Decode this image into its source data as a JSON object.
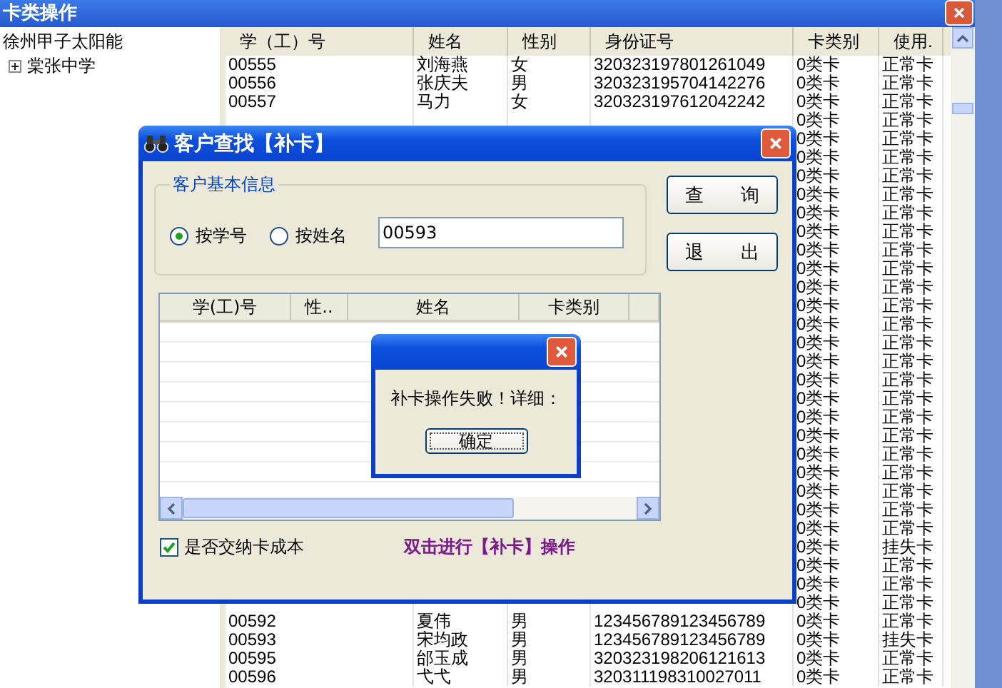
{
  "main_window": {
    "title": "卡类操作",
    "tree": {
      "root": "徐州甲子太阳能",
      "children": [
        {
          "label": "棠张中学",
          "expanded": false
        }
      ]
    },
    "table": {
      "columns": [
        "学（工）号",
        "姓名",
        "性别",
        "身份证号",
        "卡类别",
        "使用."
      ],
      "rows": [
        {
          "id": "00555",
          "name": "刘海燕",
          "gender": "女",
          "id_card": "320323197801261049",
          "card_type": "0类卡",
          "status": "正常卡"
        },
        {
          "id": "00556",
          "name": "张庆夫",
          "gender": "男",
          "id_card": "320323195704142276",
          "card_type": "0类卡",
          "status": "正常卡"
        },
        {
          "id": "00557",
          "name": "马力",
          "gender": "女",
          "id_card": "320323197612042242",
          "card_type": "0类卡",
          "status": "正常卡"
        },
        {
          "card_type": "0类卡",
          "status": "正常卡"
        },
        {
          "card_type": "0类卡",
          "status": "正常卡"
        },
        {
          "card_type": "0类卡",
          "status": "正常卡"
        },
        {
          "card_type": "0类卡",
          "status": "正常卡"
        },
        {
          "card_type": "0类卡",
          "status": "正常卡"
        },
        {
          "card_type": "0类卡",
          "status": "正常卡"
        },
        {
          "card_type": "0类卡",
          "status": "正常卡"
        },
        {
          "card_type": "0类卡",
          "status": "正常卡"
        },
        {
          "card_type": "0类卡",
          "status": "正常卡"
        },
        {
          "card_type": "0类卡",
          "status": "正常卡"
        },
        {
          "card_type": "0类卡",
          "status": "正常卡"
        },
        {
          "card_type": "0类卡",
          "status": "正常卡"
        },
        {
          "card_type": "0类卡",
          "status": "正常卡"
        },
        {
          "card_type": "0类卡",
          "status": "正常卡"
        },
        {
          "card_type": "0类卡",
          "status": "正常卡"
        },
        {
          "card_type": "0类卡",
          "status": "正常卡"
        },
        {
          "card_type": "0类卡",
          "status": "正常卡"
        },
        {
          "card_type": "0类卡",
          "status": "正常卡"
        },
        {
          "card_type": "0类卡",
          "status": "正常卡"
        },
        {
          "card_type": "0类卡",
          "status": "正常卡"
        },
        {
          "card_type": "0类卡",
          "status": "正常卡"
        },
        {
          "card_type": "0类卡",
          "status": "正常卡"
        },
        {
          "card_type": "0类卡",
          "status": "正常卡"
        },
        {
          "card_type": "0类卡",
          "status": "挂失卡"
        },
        {
          "card_type": "0类卡",
          "status": "正常卡"
        },
        {
          "card_type": "0类卡",
          "status": "正常卡"
        },
        {
          "card_type": "0类卡",
          "status": "正常卡"
        },
        {
          "id": "00592",
          "name": "夏伟",
          "gender": "男",
          "id_card": "123456789123456789",
          "card_type": "0类卡",
          "status": "正常卡"
        },
        {
          "id": "00593",
          "name": "宋均政",
          "gender": "男",
          "id_card": "123456789123456789",
          "card_type": "0类卡",
          "status": "挂失卡"
        },
        {
          "id": "00595",
          "name": "邰玉成",
          "gender": "男",
          "id_card": "320323198206121613",
          "card_type": "0类卡",
          "status": "正常卡"
        },
        {
          "id": "00596",
          "name": "弋弋",
          "gender": "男",
          "id_card": "320311198310027011",
          "card_type": "0类卡",
          "status": "正常卡"
        }
      ]
    }
  },
  "dialog": {
    "title": "客户查找【补卡】",
    "group_title": "客户基本信息",
    "search_modes": [
      {
        "label": "按学号",
        "selected": true
      },
      {
        "label": "按姓名",
        "selected": false
      }
    ],
    "search_value": "00593",
    "buttons": [
      "查　　询",
      "退　　出"
    ],
    "list_columns": [
      "学(工)号",
      "性..",
      "姓名",
      "卡类别"
    ],
    "cost_checkbox": {
      "label": "是否交纳卡成本",
      "checked": true
    },
    "hint": "双击进行【补卡】操作"
  },
  "message_box": {
    "text": "补卡操作失败！详细：",
    "button": "确定"
  }
}
